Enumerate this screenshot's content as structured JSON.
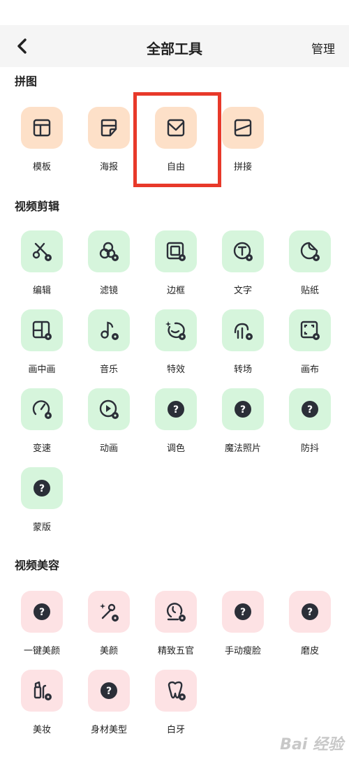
{
  "header": {
    "title": "全部工具",
    "manage_label": "管理",
    "back_icon": "chevron-left-icon"
  },
  "sections": {
    "collage": {
      "title": "拼图"
    },
    "video_edit": {
      "title": "视频剪辑"
    },
    "video_beauty": {
      "title": "视频美容"
    }
  },
  "collage_tools": [
    {
      "label": "模板",
      "icon": "template-icon"
    },
    {
      "label": "海报",
      "icon": "poster-icon"
    },
    {
      "label": "自由",
      "icon": "freestyle-icon"
    },
    {
      "label": "拼接",
      "icon": "stitch-icon"
    }
  ],
  "edit_tools": [
    {
      "label": "编辑",
      "icon": "scissors-icon"
    },
    {
      "label": "滤镜",
      "icon": "filter-icon"
    },
    {
      "label": "边框",
      "icon": "border-icon"
    },
    {
      "label": "文字",
      "icon": "text-icon"
    },
    {
      "label": "贴纸",
      "icon": "sticker-icon"
    },
    {
      "label": "画中画",
      "icon": "pip-icon"
    },
    {
      "label": "音乐",
      "icon": "music-icon"
    },
    {
      "label": "特效",
      "icon": "effects-icon"
    },
    {
      "label": "转场",
      "icon": "transition-icon"
    },
    {
      "label": "画布",
      "icon": "canvas-icon"
    },
    {
      "label": "变速",
      "icon": "speed-icon"
    },
    {
      "label": "动画",
      "icon": "animation-icon"
    },
    {
      "label": "调色",
      "icon": "question-icon"
    },
    {
      "label": "魔法照片",
      "icon": "question-icon"
    },
    {
      "label": "防抖",
      "icon": "question-icon"
    },
    {
      "label": "蒙版",
      "icon": "question-icon"
    }
  ],
  "beauty_tools": [
    {
      "label": "一键美颜",
      "icon": "question-icon"
    },
    {
      "label": "美颜",
      "icon": "beauty-wand-icon"
    },
    {
      "label": "精致五官",
      "icon": "face-icon"
    },
    {
      "label": "手动瘦脸",
      "icon": "question-icon"
    },
    {
      "label": "磨皮",
      "icon": "question-icon"
    },
    {
      "label": "美妆",
      "icon": "makeup-icon"
    },
    {
      "label": "身材美型",
      "icon": "question-icon"
    },
    {
      "label": "白牙",
      "icon": "tooth-icon"
    }
  ],
  "watermark": "Bai 经验",
  "colors": {
    "highlight": "#e8392a",
    "orange_tile": "#fde0c8",
    "green_tile": "#d6f5dc",
    "pink_tile": "#fde2e4",
    "icon_stroke": "#2b2f38"
  }
}
